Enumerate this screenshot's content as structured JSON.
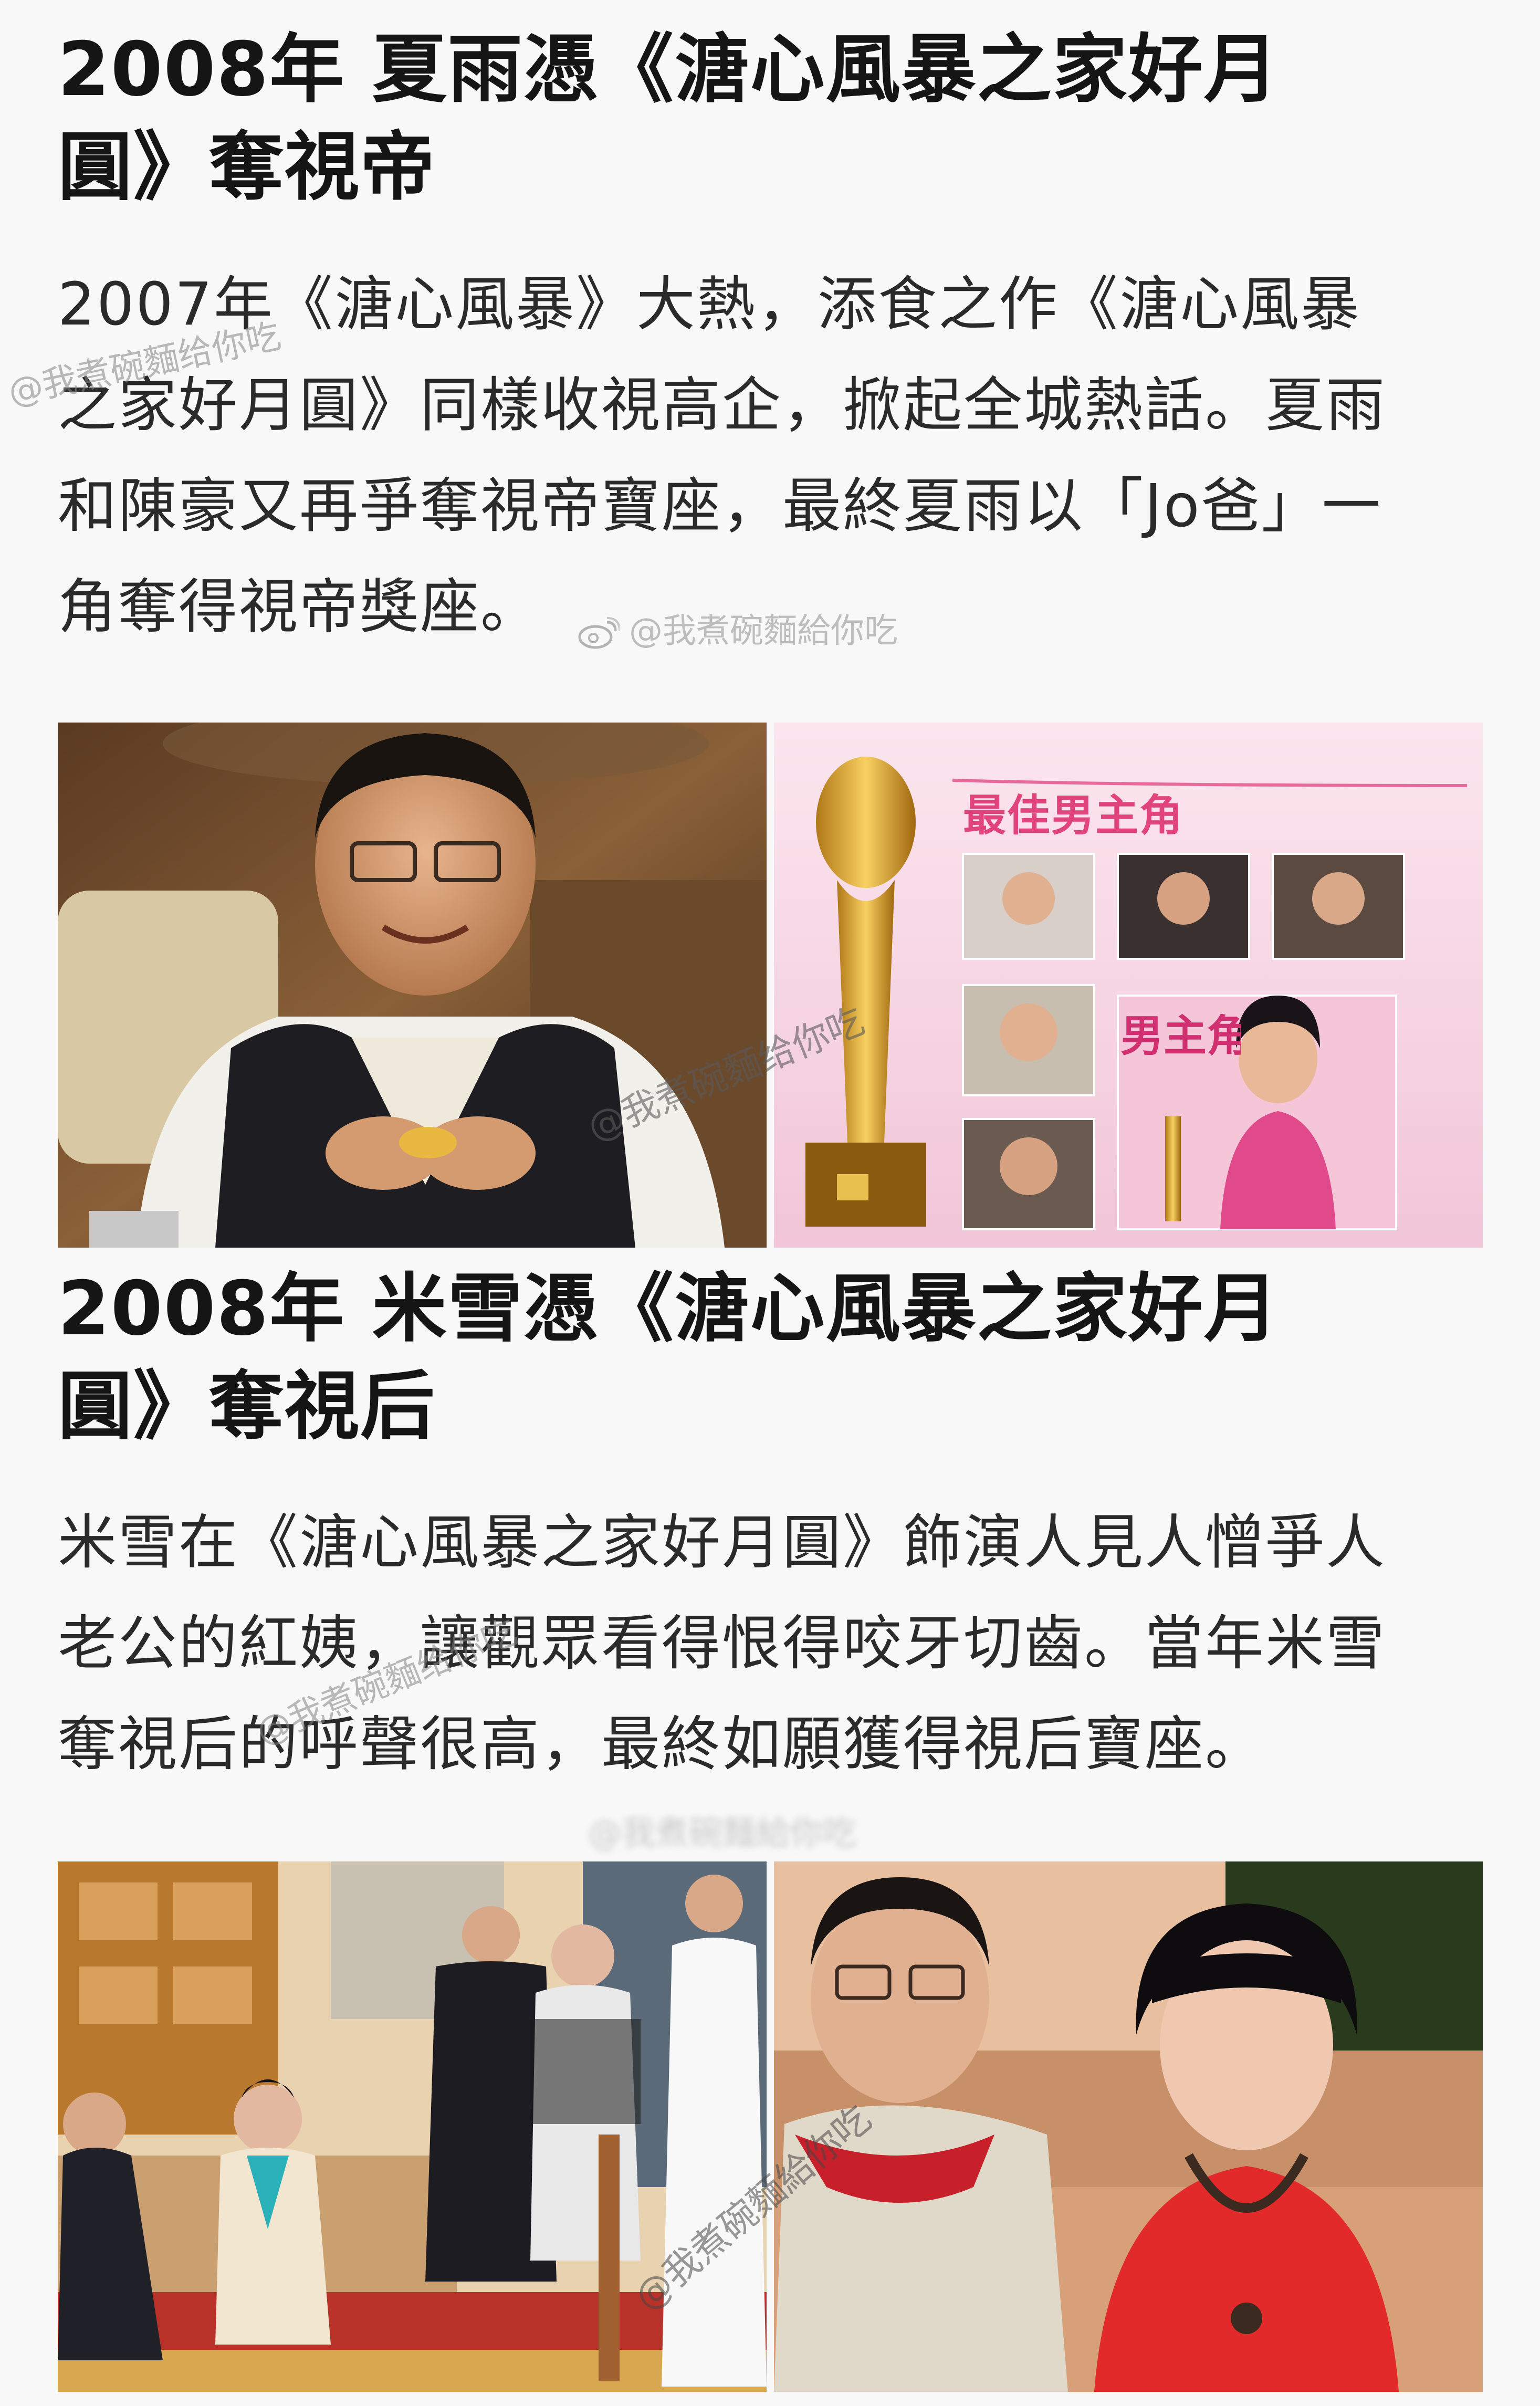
{
  "section1": {
    "heading_line1": "2008年 夏雨憑《溏心風暴之家好月",
    "heading_line2": "圓》奪視帝",
    "body_line1": "2007年《溏心風暴》大熱，添食之作《溏心風暴",
    "body_line2": "之家好月圓》同樣收視高企，掀起全城熱話。夏雨",
    "body_line3": "和陳豪又再爭奪視帝寶座，最終夏雨以「Jo爸」一",
    "body_line4": "角奪得視帝獎座。",
    "award_banner": "最佳男主角",
    "award_banner_partial": "男主角"
  },
  "section2": {
    "heading_line1": "2008年 米雪憑《溏心風暴之家好月",
    "heading_line2": "圓》奪視后",
    "body_line1": "米雪在《溏心風暴之家好月圓》飾演人見人憎爭人",
    "body_line2": "老公的紅姨，讓觀眾看得恨得咬牙切齒。當年米雪",
    "body_line3": "奪視后的呼聲很高，最終如願獲得視后寶座。"
  },
  "watermarks": {
    "handle": "@我煮碗麵給你吃",
    "handle_simplified": "@我煮碗麵给你吃",
    "weibo_handle": "@我煮碗麵給你吃"
  },
  "icons": {
    "weibo": "weibo-logo-icon"
  },
  "colors": {
    "background": "#f8f8f8",
    "heading": "#151515",
    "body": "#2a2a2a",
    "award_pink": "#e0447a"
  }
}
